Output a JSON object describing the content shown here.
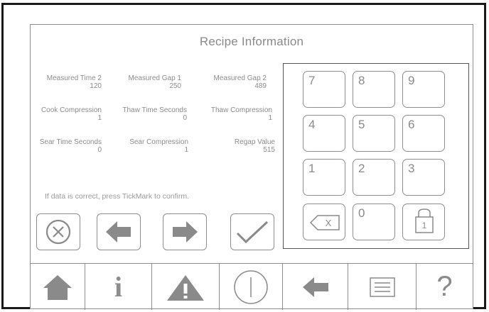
{
  "screen": {
    "title": "Recipe Information",
    "hint": "If data is correct, press TickMark to confirm."
  },
  "fields": [
    {
      "label": "Measured Time 2",
      "value": "120"
    },
    {
      "label": "Measured Gap 1",
      "value": "250"
    },
    {
      "label": "Measured Gap 2",
      "value": "489"
    },
    {
      "label": "Cook Compression",
      "value": "1"
    },
    {
      "label": "Thaw Time Seconds",
      "value": "0"
    },
    {
      "label": "Thaw Compression",
      "value": "1"
    },
    {
      "label": "Sear Time Seconds",
      "value": "0"
    },
    {
      "label": "Sear Compression",
      "value": "1"
    },
    {
      "label": "Regap Value",
      "value": "515"
    }
  ],
  "keypad": {
    "keys": [
      "7",
      "8",
      "9",
      "4",
      "5",
      "6",
      "1",
      "2",
      "3",
      "0"
    ],
    "backspace_glyph": "X",
    "lock_glyph": "1"
  },
  "actions": [
    "cancel-icon",
    "arrow-left-icon",
    "arrow-right-icon",
    "checkmark-icon"
  ],
  "nav": [
    "home-icon",
    "info-icon",
    "warning-icon",
    "power-icon",
    "back-arrow-icon",
    "list-icon",
    "help-icon"
  ],
  "nav_labels": {
    "help": "?",
    "info": "i"
  },
  "colors": {
    "ui_gray": "#8e8e8e",
    "icon_gray": "#8a8a8a",
    "frame": "#1a1a1a"
  }
}
